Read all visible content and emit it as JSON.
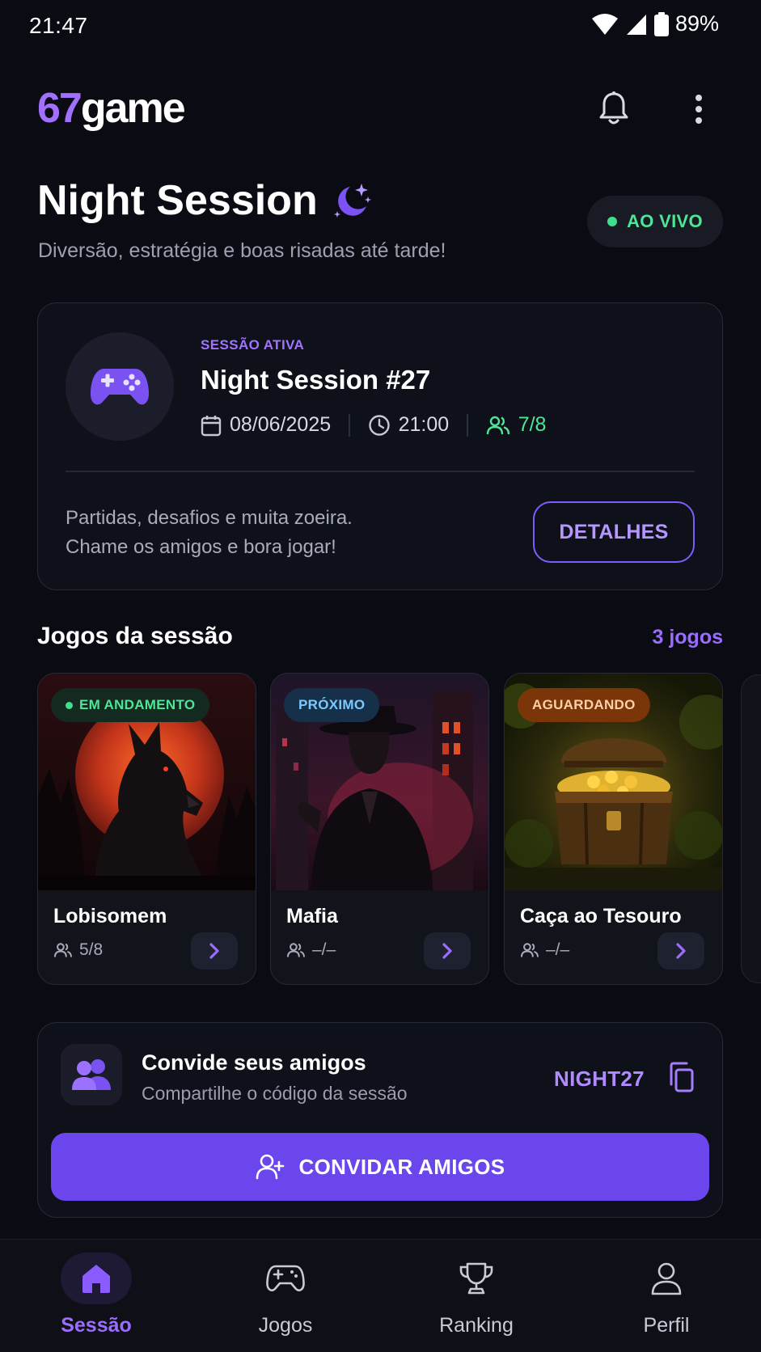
{
  "status_bar": {
    "time": "21:47",
    "battery": "89%"
  },
  "header": {
    "logo_number": "67",
    "logo_word": "game",
    "bell_icon": "bell-icon",
    "menu_icon": "more-vertical-icon"
  },
  "hero": {
    "title": "Night Session",
    "title_icon": "moon-stars-icon",
    "subtitle": "Diversão, estratégia e boas risadas até tarde!",
    "live_badge": "AO VIVO"
  },
  "session_card": {
    "kicker": "SESSÃO ATIVA",
    "name": "Night Session #27",
    "date": "08/06/2025",
    "time": "21:00",
    "players": "7/8",
    "description_line1": "Partidas, desafios e muita zoeira.",
    "description_line2": "Chame os amigos e bora jogar!",
    "details_button": "DETALHES"
  },
  "games_section": {
    "title": "Jogos da sessão",
    "count": "3 jogos",
    "games": [
      {
        "name": "Lobisomem",
        "status": "EM ANDAMENTO",
        "players": "5/8"
      },
      {
        "name": "Mafia",
        "status": "PRÓXIMO",
        "players": "–/–"
      },
      {
        "name": "Caça ao Tesouro",
        "status": "AGUARDANDO",
        "players": "–/–"
      }
    ]
  },
  "invite": {
    "title": "Convide seus amigos",
    "subtitle": "Compartilhe o código da sessão",
    "code": "NIGHT27",
    "button": "CONVIDAR AMIGOS"
  },
  "bottom_nav": {
    "items": [
      {
        "label": "Sessão",
        "icon": "home-icon",
        "active": true
      },
      {
        "label": "Jogos",
        "icon": "gamepad-icon",
        "active": false
      },
      {
        "label": "Ranking",
        "icon": "trophy-icon",
        "active": false
      },
      {
        "label": "Perfil",
        "icon": "user-icon",
        "active": false
      }
    ]
  },
  "colors": {
    "accent": "#7d5cff",
    "live_green": "#3ee08a",
    "background": "#0b0c13",
    "status_playing_bg": "#14291f",
    "status_next_bg": "#16304a",
    "status_waiting_bg": "#7a3508"
  }
}
